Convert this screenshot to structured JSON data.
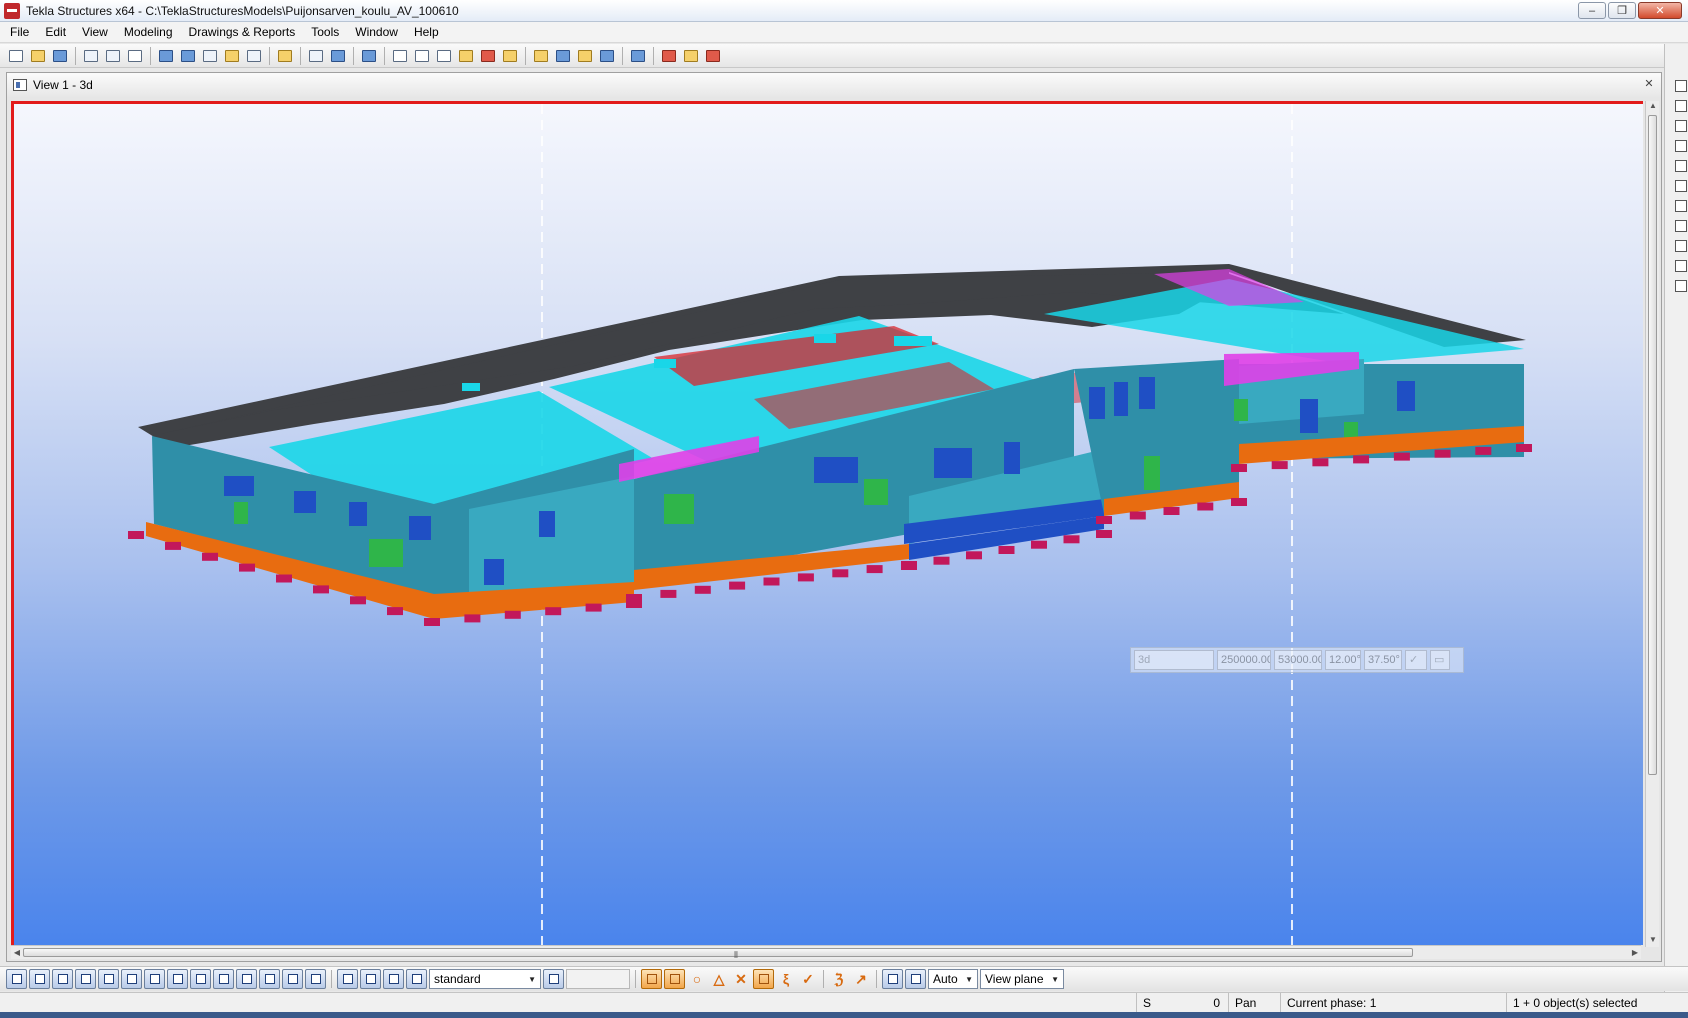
{
  "window": {
    "title": "Tekla Structures x64 - C:\\TeklaStructuresModels\\Puijonsarven_koulu_AV_100610",
    "min_label": "‒",
    "max_label": "❐",
    "close_label": "✕"
  },
  "menu": {
    "items": [
      "File",
      "Edit",
      "View",
      "Modeling",
      "Drawings & Reports",
      "Tools",
      "Window",
      "Help"
    ]
  },
  "toolbar": {
    "icons": [
      "new-model",
      "open-model",
      "save-model",
      "print",
      "print-preview",
      "plot",
      "view-window",
      "window-layout",
      "window-tile",
      "cut",
      "copy",
      "paste-special",
      "select-filter",
      "pick-point",
      "object-properties",
      "help-pointer",
      "grid",
      "grid-line",
      "rotate",
      "measure-angle",
      "arc",
      "clip-plane",
      "copy-object",
      "move-object",
      "mirror",
      "numbering",
      "report",
      "delete",
      "refresh",
      "palette"
    ]
  },
  "view": {
    "title": "View 1 - 3d",
    "close_label": "✕"
  },
  "model": {
    "colors": {
      "roof": "#3f4145",
      "walls": "#2f8fa8",
      "wall_light": "#39a9c0",
      "cyan_beams": "#19d6e8",
      "foundation": "#e86c10",
      "footings": "#c2185b",
      "windows": "#1f4fc4",
      "trusses": "#e040e8",
      "red_rafters": "#d8262c",
      "green_doors": "#2fb54a"
    }
  },
  "coordinate_readout": {
    "view_name": "3d",
    "x": "250000.00",
    "y": "53000.00",
    "angle_1": "12.00°",
    "angle_2": "37.50°"
  },
  "bottom_toolbar": {
    "filter_select": "standard",
    "snap_depth": "Auto",
    "plane_select": "View plane"
  },
  "status": {
    "s_label": "S",
    "s_value": "0",
    "mode": "Pan",
    "phase": "Current phase: 1",
    "selection": "1 + 0 object(s) selected"
  }
}
